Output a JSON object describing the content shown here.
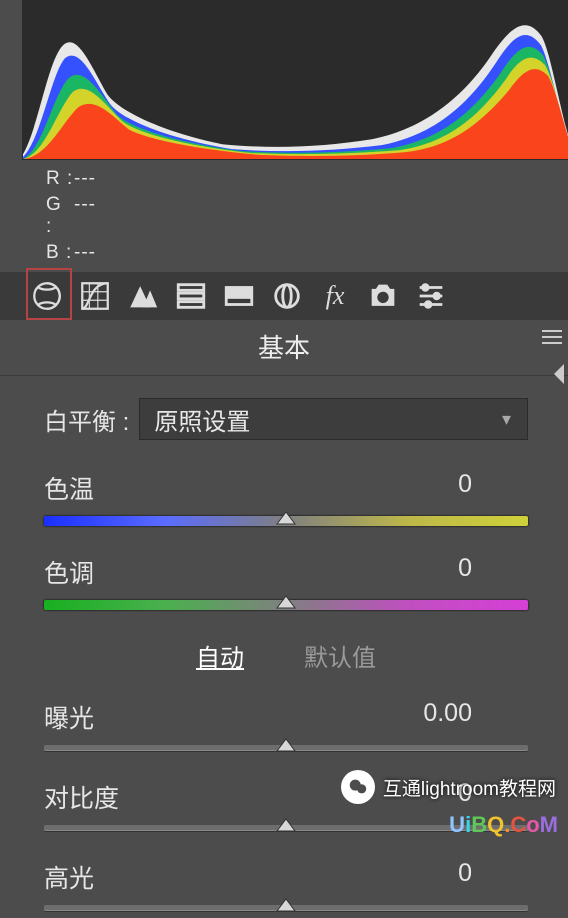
{
  "histogram": {
    "channels": [
      "R",
      "G",
      "B"
    ]
  },
  "readout": {
    "r_label": "R :",
    "r_value": "---",
    "g_label": "G :",
    "g_value": "---",
    "b_label": "B :",
    "b_value": "---"
  },
  "panel": {
    "title": "基本"
  },
  "white_balance": {
    "label": "白平衡 :",
    "selected": "原照设置"
  },
  "temperature": {
    "label": "色温",
    "value": "0"
  },
  "tint": {
    "label": "色调",
    "value": "0"
  },
  "auto_row": {
    "auto": "自动",
    "default": "默认值"
  },
  "exposure": {
    "label": "曝光",
    "value": "0.00"
  },
  "contrast": {
    "label": "对比度",
    "value": "0"
  },
  "highlights": {
    "label": "高光",
    "value": "0"
  },
  "watermark": {
    "text": "互通lightroom教程网"
  },
  "logo": {
    "chars": [
      "U",
      "i",
      "B",
      "Q",
      ".",
      "C",
      "o",
      "M"
    ]
  },
  "tools": [
    {
      "name": "basic-icon"
    },
    {
      "name": "curve-icon"
    },
    {
      "name": "detail-icon"
    },
    {
      "name": "hsl-icon"
    },
    {
      "name": "split-tone-icon"
    },
    {
      "name": "lens-icon"
    },
    {
      "name": "fx-icon"
    },
    {
      "name": "camera-icon"
    },
    {
      "name": "presets-icon"
    }
  ]
}
